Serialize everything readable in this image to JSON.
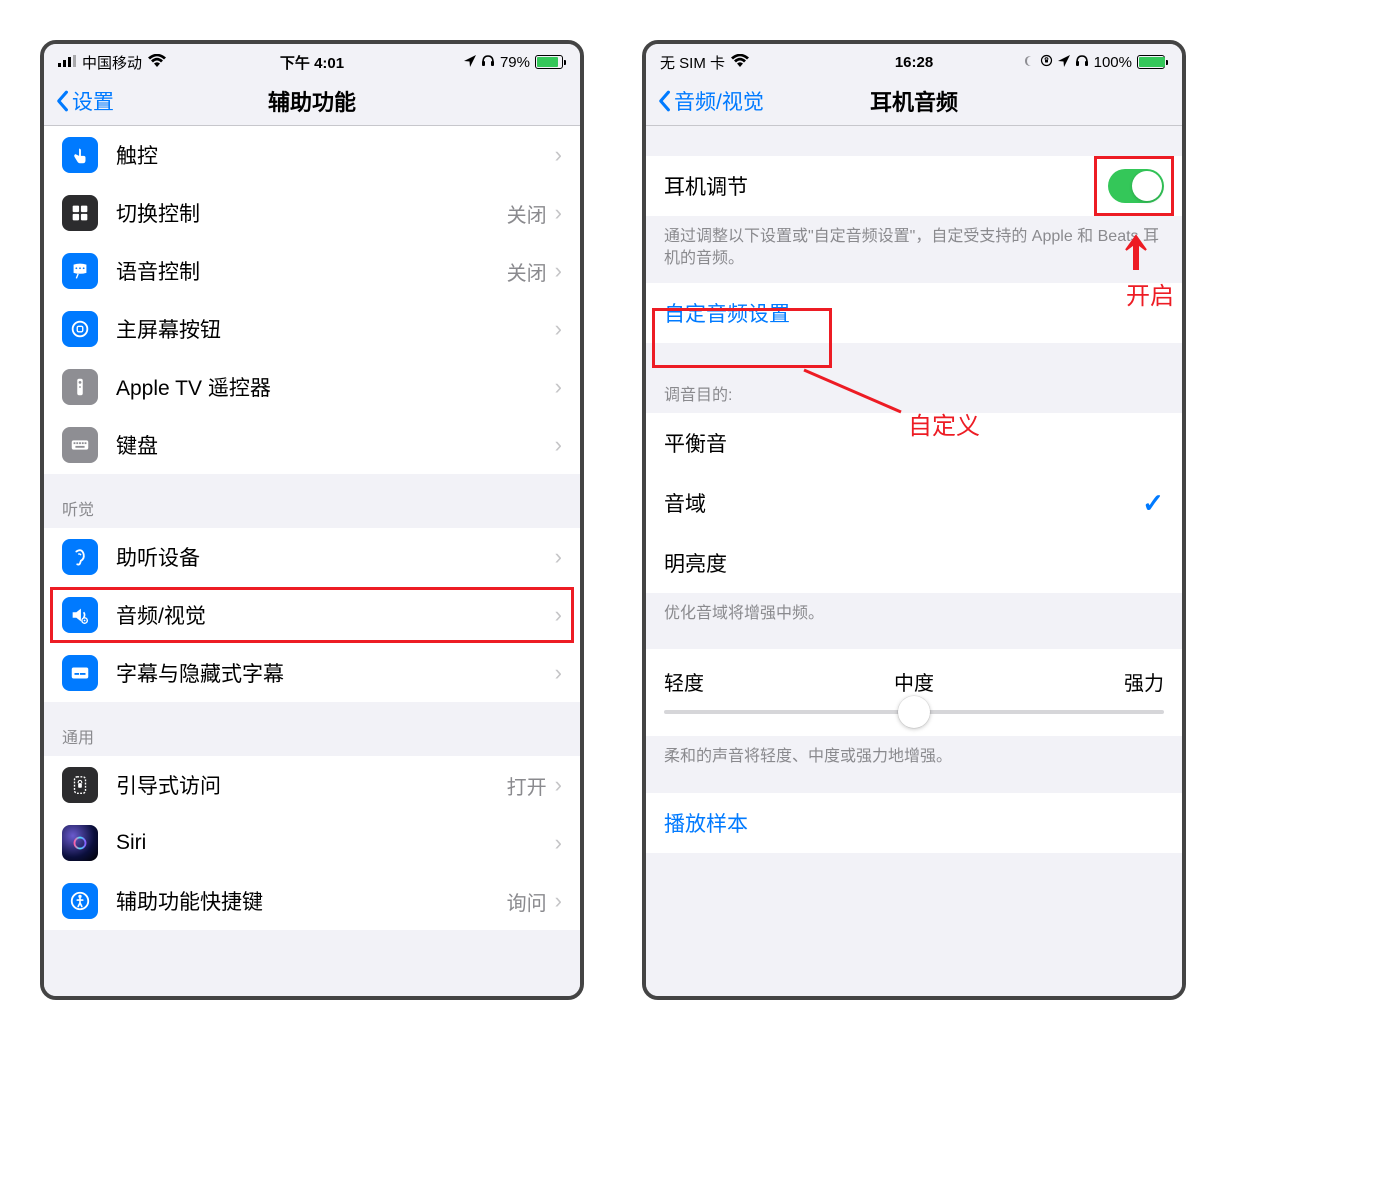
{
  "left": {
    "status": {
      "carrier": "中国移动",
      "time": "下午 4:01",
      "battery_pct": "79%"
    },
    "nav": {
      "back": "设置",
      "title": "辅助功能"
    },
    "group1": [
      {
        "label": "触控",
        "icon": "touch-icon",
        "icon_bg": "ic-blue"
      },
      {
        "label": "切换控制",
        "value": "关闭",
        "icon": "switch-control-icon",
        "icon_bg": "ic-black"
      },
      {
        "label": "语音控制",
        "value": "关闭",
        "icon": "voice-control-icon",
        "icon_bg": "ic-blue"
      },
      {
        "label": "主屏幕按钮",
        "icon": "home-button-icon",
        "icon_bg": "ic-blue"
      },
      {
        "label": "Apple TV 遥控器",
        "icon": "remote-icon",
        "icon_bg": "ic-gray"
      },
      {
        "label": "键盘",
        "icon": "keyboard-icon",
        "icon_bg": "ic-gray"
      }
    ],
    "section_hearing": "听觉",
    "group2": [
      {
        "label": "助听设备",
        "icon": "hearing-icon",
        "icon_bg": "ic-blue"
      },
      {
        "label": "音频/视觉",
        "icon": "audio-visual-icon",
        "icon_bg": "ic-blue",
        "highlight": true
      },
      {
        "label": "字幕与隐藏式字幕",
        "icon": "subtitles-icon",
        "icon_bg": "ic-blue"
      }
    ],
    "section_general": "通用",
    "group3": [
      {
        "label": "引导式访问",
        "value": "打开",
        "icon": "guided-access-icon",
        "icon_bg": "ic-black"
      },
      {
        "label": "Siri",
        "icon": "siri-icon",
        "icon_bg": "ic-siri"
      },
      {
        "label": "辅助功能快捷键",
        "value": "询问",
        "icon": "shortcut-icon",
        "icon_bg": "ic-blue"
      }
    ]
  },
  "right": {
    "status": {
      "carrier": "无 SIM 卡",
      "time": "16:28",
      "battery_pct": "100%"
    },
    "nav": {
      "back": "音频/视觉",
      "title": "耳机音频"
    },
    "headphone_adjust": {
      "label": "耳机调节",
      "toggle_on": true
    },
    "desc1": "通过调整以下设置或\"自定音频设置\"，自定受支持的 Apple 和 Beats 耳机的音频。",
    "custom_audio": "自定音频设置",
    "tune_header": "调音目的:",
    "options": [
      {
        "label": "平衡音"
      },
      {
        "label": "音域",
        "checked": true
      },
      {
        "label": "明亮度"
      }
    ],
    "desc2": "优化音域将增强中频。",
    "slider": {
      "low": "轻度",
      "mid": "中度",
      "high": "强力"
    },
    "desc3": "柔和的声音将轻度、中度或强力地增强。",
    "play_sample": "播放样本",
    "annotations": {
      "enable": "开启",
      "custom": "自定义"
    }
  }
}
